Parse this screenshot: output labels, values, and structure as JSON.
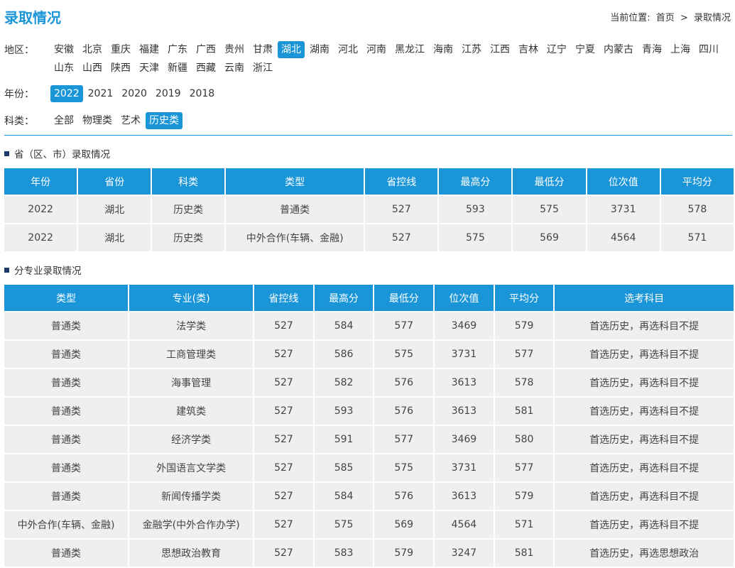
{
  "header": {
    "title": "录取情况",
    "breadcrumb_prefix": "当前位置:",
    "breadcrumb_home": "首页",
    "breadcrumb_sep": ">",
    "breadcrumb_current": "录取情况"
  },
  "filters": {
    "region": {
      "label": "地区：",
      "selected": "湖北",
      "options": [
        "安徽",
        "北京",
        "重庆",
        "福建",
        "广东",
        "广西",
        "贵州",
        "甘肃",
        "湖北",
        "湖南",
        "河北",
        "河南",
        "黑龙江",
        "海南",
        "江苏",
        "江西",
        "吉林",
        "辽宁",
        "宁夏",
        "内蒙古",
        "青海",
        "上海",
        "四川",
        "山东",
        "山西",
        "陕西",
        "天津",
        "新疆",
        "西藏",
        "云南",
        "浙江"
      ]
    },
    "year": {
      "label": "年份：",
      "selected": "2022",
      "options": [
        "2022",
        "2021",
        "2020",
        "2019",
        "2018"
      ]
    },
    "subject": {
      "label": "科类：",
      "selected": "历史类",
      "options": [
        "全部",
        "物理类",
        "艺术",
        "历史类"
      ]
    }
  },
  "province_section": {
    "title": "省（区、市）录取情况",
    "headers": [
      "年份",
      "省份",
      "科类",
      "类型",
      "省控线",
      "最高分",
      "最低分",
      "位次值",
      "平均分"
    ],
    "rows": [
      [
        "2022",
        "湖北",
        "历史类",
        "普通类",
        "527",
        "593",
        "575",
        "3731",
        "578"
      ],
      [
        "2022",
        "湖北",
        "历史类",
        "中外合作(车辆、金融)",
        "527",
        "575",
        "569",
        "4564",
        "571"
      ]
    ]
  },
  "major_section": {
    "title": "分专业录取情况",
    "headers": [
      "类型",
      "专业(类)",
      "省控线",
      "最高分",
      "最低分",
      "位次值",
      "平均分",
      "选考科目"
    ],
    "rows": [
      [
        "普通类",
        "法学类",
        "527",
        "584",
        "577",
        "3469",
        "579",
        "首选历史，再选科目不提"
      ],
      [
        "普通类",
        "工商管理类",
        "527",
        "586",
        "575",
        "3731",
        "577",
        "首选历史，再选科目不提"
      ],
      [
        "普通类",
        "海事管理",
        "527",
        "582",
        "576",
        "3613",
        "578",
        "首选历史，再选科目不提"
      ],
      [
        "普通类",
        "建筑类",
        "527",
        "593",
        "576",
        "3613",
        "581",
        "首选历史，再选科目不提"
      ],
      [
        "普通类",
        "经济学类",
        "527",
        "591",
        "577",
        "3469",
        "580",
        "首选历史，再选科目不提"
      ],
      [
        "普通类",
        "外国语言文学类",
        "527",
        "585",
        "575",
        "3731",
        "577",
        "首选历史，再选科目不提"
      ],
      [
        "普通类",
        "新闻传播学类",
        "527",
        "584",
        "576",
        "3613",
        "579",
        "首选历史，再选科目不提"
      ],
      [
        "中外合作(车辆、金融)",
        "金融学(中外合作办学)",
        "527",
        "575",
        "569",
        "4564",
        "571",
        "首选历史，再选科目不提"
      ],
      [
        "普通类",
        "思想政治教育",
        "527",
        "583",
        "579",
        "3247",
        "581",
        "首选历史，再选思想政治"
      ]
    ]
  }
}
